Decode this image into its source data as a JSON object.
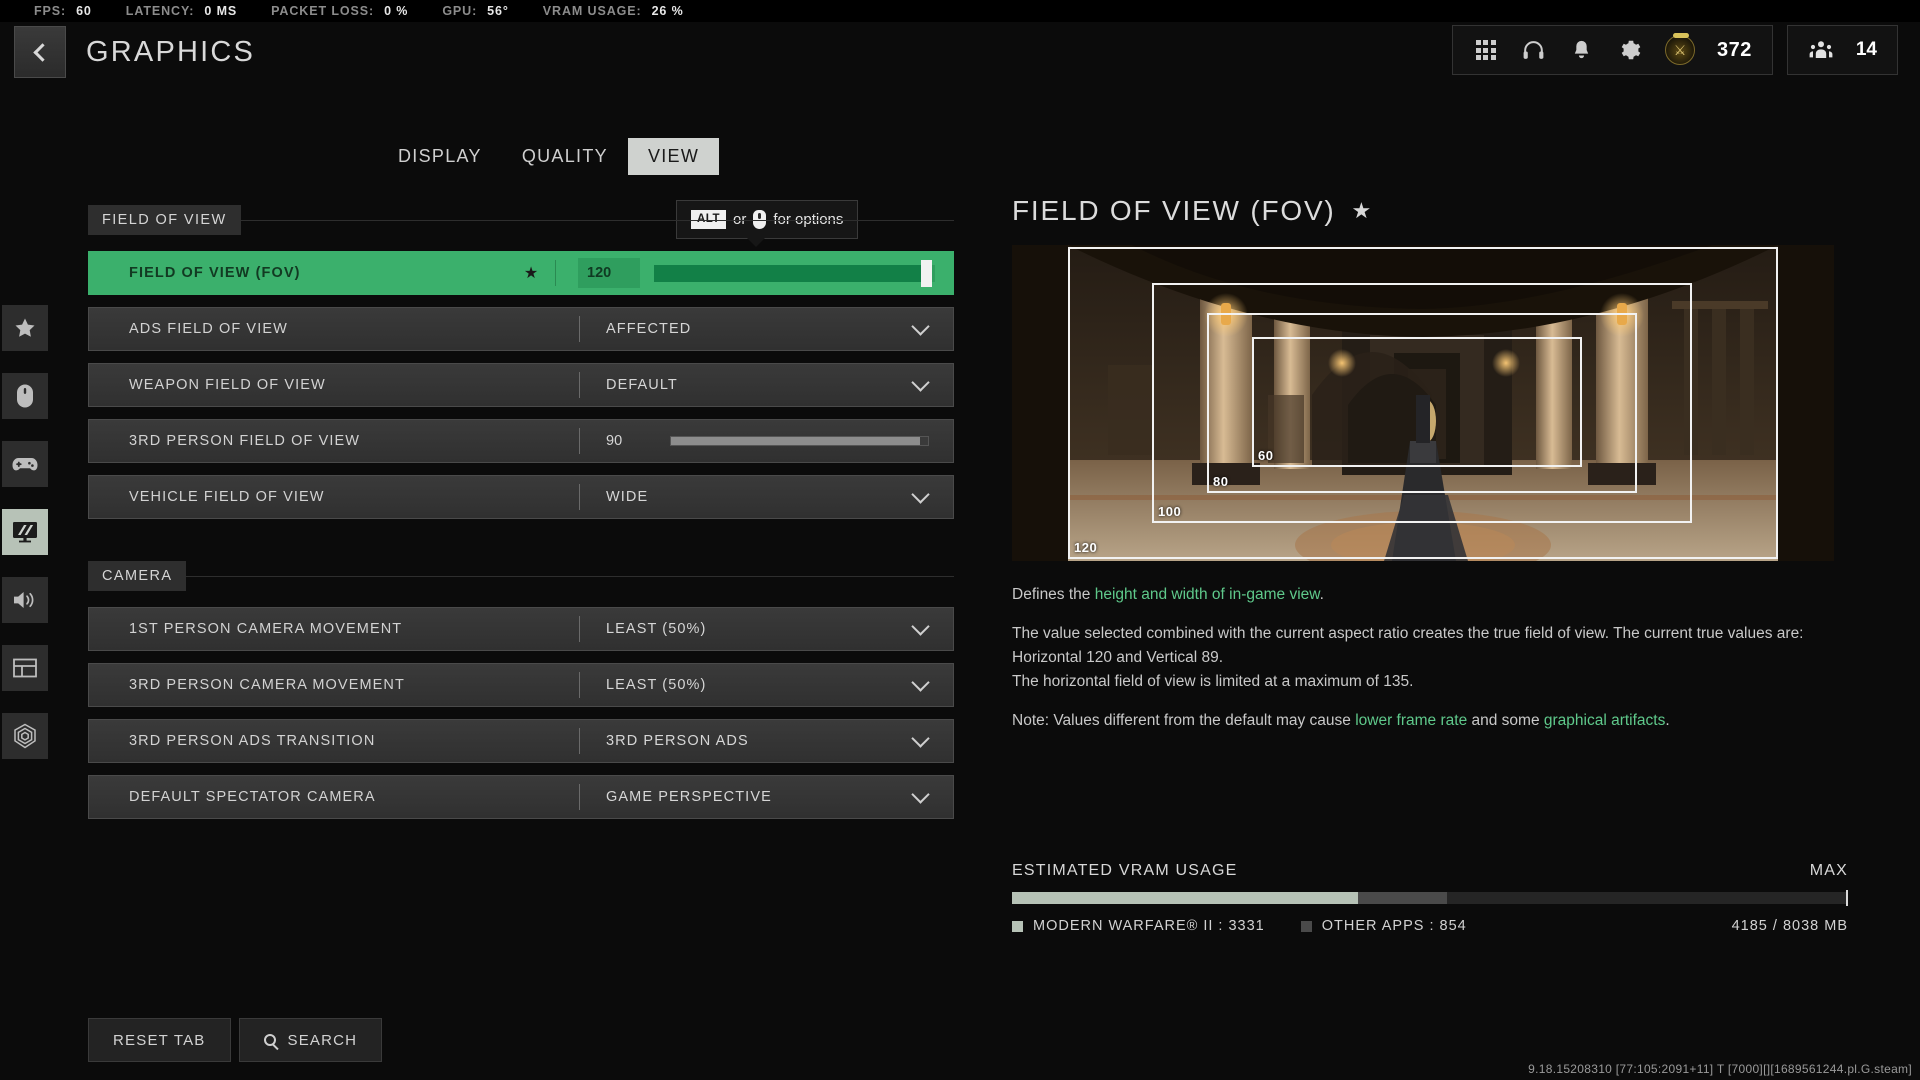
{
  "perf_bar": [
    {
      "label": "FPS:",
      "value": "60"
    },
    {
      "label": "LATENCY:",
      "value": "0 MS"
    },
    {
      "label": "PACKET LOSS:",
      "value": "0 %"
    },
    {
      "label": "GPU:",
      "value": "56°"
    },
    {
      "label": "VRAM USAGE:",
      "value": "26 %"
    }
  ],
  "header": {
    "title": "GRAPHICS",
    "back_icon": "chevron-left-icon",
    "icons": [
      "apps-grid-icon",
      "headset-icon",
      "bell-icon",
      "gear-icon"
    ],
    "emblem_count": "372",
    "party_count": "14"
  },
  "rail": [
    {
      "name": "favorites",
      "icon": "star-icon"
    },
    {
      "name": "mouse-keyboard",
      "icon": "mouse-icon"
    },
    {
      "name": "controller",
      "icon": "gamepad-icon"
    },
    {
      "name": "graphics",
      "icon": "monitor-icon",
      "active": true
    },
    {
      "name": "audio",
      "icon": "speaker-icon"
    },
    {
      "name": "interface",
      "icon": "layout-icon"
    },
    {
      "name": "account",
      "icon": "network-icon"
    }
  ],
  "tabs": [
    {
      "label": "DISPLAY",
      "active": false
    },
    {
      "label": "QUALITY",
      "active": false
    },
    {
      "label": "VIEW",
      "active": true
    }
  ],
  "tooltip": {
    "key": "ALT",
    "mid": "or",
    "mouse_icon": "mouse-icon",
    "suffix": "for options"
  },
  "sections": [
    {
      "title": "FIELD OF VIEW",
      "rows": [
        {
          "label": "FIELD OF VIEW (FOV)",
          "type": "slider",
          "value": "120",
          "fill_pct": 96,
          "selected": true,
          "favorite": true,
          "star": "★"
        },
        {
          "label": "ADS FIELD OF VIEW",
          "type": "dropdown",
          "value": "AFFECTED"
        },
        {
          "label": "WEAPON FIELD OF VIEW",
          "type": "dropdown",
          "value": "DEFAULT"
        },
        {
          "label": "3RD PERSON FIELD OF VIEW",
          "type": "slider",
          "value": "90",
          "fill_pct": 97
        },
        {
          "label": "VEHICLE FIELD OF VIEW",
          "type": "dropdown",
          "value": "WIDE"
        }
      ]
    },
    {
      "title": "CAMERA",
      "rows": [
        {
          "label": "1ST PERSON CAMERA MOVEMENT",
          "type": "dropdown",
          "value": "LEAST (50%)"
        },
        {
          "label": "3RD PERSON CAMERA MOVEMENT",
          "type": "dropdown",
          "value": "LEAST (50%)"
        },
        {
          "label": "3RD PERSON ADS TRANSITION",
          "type": "dropdown",
          "value": "3RD PERSON ADS"
        },
        {
          "label": "DEFAULT SPECTATOR CAMERA",
          "type": "dropdown",
          "value": "GAME PERSPECTIVE"
        }
      ]
    }
  ],
  "detail": {
    "title": "FIELD OF VIEW (FOV)",
    "star": "★",
    "preview_labels": [
      "60",
      "80",
      "100",
      "120"
    ],
    "desc_line1_pre": "Defines the ",
    "desc_line1_green": "height and width of in-game view",
    "desc_line1_post": ".",
    "desc_para2_a": "The value selected combined with the current aspect ratio creates the true field of view. The current true values are: Horizontal 120 and Vertical 89.",
    "desc_para2_b": "The horizontal field of view is limited at a maximum of 135.",
    "desc_note_pre": "Note: Values different from the default may cause ",
    "desc_note_g1": "lower frame rate",
    "desc_note_mid": " and some ",
    "desc_note_g2": "graphical artifacts",
    "desc_note_post": "."
  },
  "vram": {
    "title": "ESTIMATED VRAM USAGE",
    "max_label": "MAX",
    "game_legend": "MODERN WARFARE® II : 3331",
    "other_legend": "OTHER APPS : 854",
    "total": "4185 / 8038 MB",
    "game_pct": 41.4,
    "other_pct": 10.6
  },
  "bottom": {
    "reset_label": "RESET TAB",
    "search_label": "SEARCH",
    "search_icon": "search-icon"
  },
  "version": "9.18.15208310 [77:105:2091+11] T [7000][][1689561244.pl.G.steam]",
  "colors": {
    "accent_green": "#3bb06c",
    "green_fill": "#128047",
    "text_green": "#5fc98b",
    "panel": "#303030",
    "bg": "#0b0b0b"
  }
}
